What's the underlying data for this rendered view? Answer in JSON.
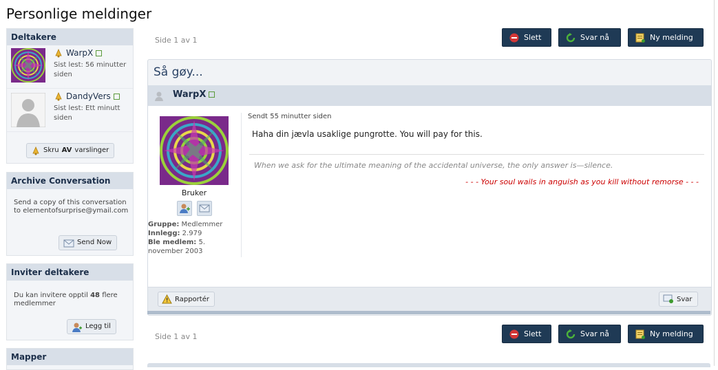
{
  "page": {
    "title": "Personlige meldinger"
  },
  "sidebar": {
    "participants": {
      "heading": "Deltakere",
      "items": [
        {
          "name": "WarpX",
          "last_read": "Sist lest: 56 minutter siden"
        },
        {
          "name": "DandyVers",
          "last_read": "Sist lest: Ett minutt siden"
        }
      ],
      "notify_label_pre": "Skru",
      "notify_label_strong": "AV",
      "notify_label_post": "varslinger"
    },
    "archive": {
      "heading": "Archive Conversation",
      "text": "Send a copy of this conversation to elementofsurprise@ymail.com",
      "button": "Send Now"
    },
    "invite": {
      "heading": "Inviter deltakere",
      "text_pre": "Du kan invitere opptil",
      "count": "48",
      "text_post": "flere medlemmer",
      "button": "Legg til"
    },
    "folders": {
      "heading": "Mapper"
    }
  },
  "toolbar": {
    "pager": "Side 1 av 1",
    "delete": "Slett",
    "reply_now": "Svar nå",
    "new_message": "Ny melding"
  },
  "post": {
    "title": "Så gøy...",
    "author": "WarpX",
    "sent": "Sendt 55 minutter siden",
    "body": "Haha din jævla usaklige pungrotte. You will pay for this.",
    "sig_quote": "When we ask for the ultimate meaning of the accidental universe, the only answer is—silence.",
    "sig_red": "- - - Your soul wails in anguish as you kill without remorse - - -",
    "role": "Bruker",
    "group_label": "Gruppe:",
    "group_value": "Medlemmer",
    "posts_label": "Innlegg:",
    "posts_value": "2.979",
    "joined_label": "Ble medlem:",
    "joined_value": "5. november 2003",
    "report": "Rapportér",
    "reply": "Svar"
  },
  "colors": {
    "accent": "#1f3a55",
    "delete_red": "#cc2b2b",
    "reply_green": "#3d9a2e",
    "sig_red": "#cc0000"
  }
}
